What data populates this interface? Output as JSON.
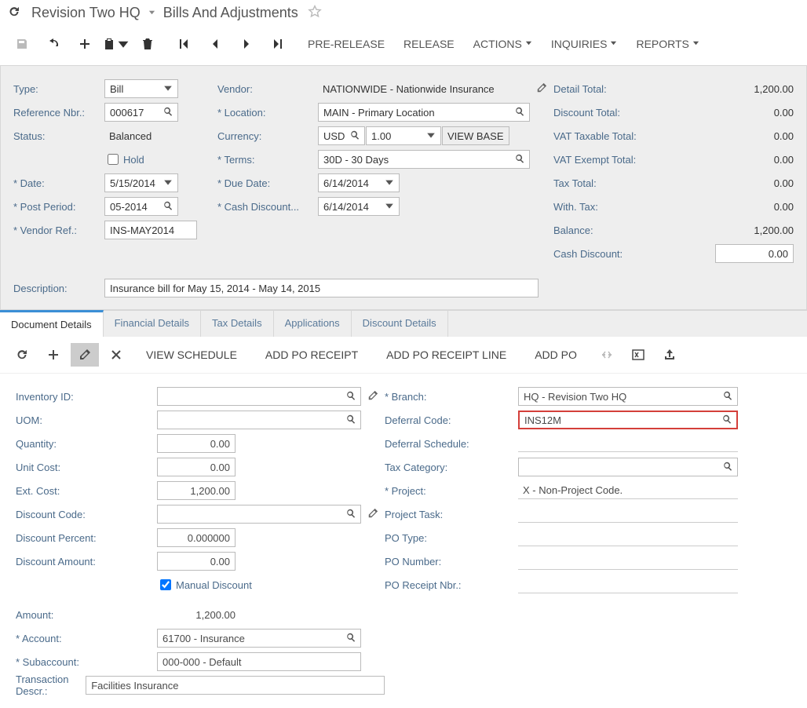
{
  "breadcrumb": {
    "company": "Revision Two HQ",
    "page": "Bills And Adjustments"
  },
  "toolbar": {
    "prerelease": "PRE-RELEASE",
    "release": "RELEASE",
    "actions": "ACTIONS",
    "inquiries": "INQUIRIES",
    "reports": "REPORTS"
  },
  "header": {
    "type_lbl": "Type:",
    "type": "Bill",
    "ref_lbl": "Reference Nbr.:",
    "ref": "000617",
    "status_lbl": "Status:",
    "status": "Balanced",
    "hold_lbl": "Hold",
    "date_lbl": "Date:",
    "date": "5/15/2014",
    "post_lbl": "Post Period:",
    "post": "05-2014",
    "vref_lbl": "Vendor Ref.:",
    "vref": "INS-MAY2014",
    "desc_lbl": "Description:",
    "desc": "Insurance bill for May 15, 2014 - May 14, 2015",
    "vendor_lbl": "Vendor:",
    "vendor": "NATIONWIDE - Nationwide Insurance",
    "location_lbl": "Location:",
    "location": "MAIN - Primary Location",
    "currency_lbl": "Currency:",
    "currency": "USD",
    "rate": "1.00",
    "viewbase": "VIEW BASE",
    "terms_lbl": "Terms:",
    "terms": "30D - 30 Days",
    "due_lbl": "Due Date:",
    "due": "6/14/2014",
    "cashdisc_lbl": "Cash Discount...",
    "cashdisc": "6/14/2014"
  },
  "totals": {
    "detail_lbl": "Detail Total:",
    "detail": "1,200.00",
    "discount_lbl": "Discount Total:",
    "discount": "0.00",
    "vattax_lbl": "VAT Taxable Total:",
    "vattax": "0.00",
    "vatex_lbl": "VAT Exempt Total:",
    "vatex": "0.00",
    "tax_lbl": "Tax Total:",
    "tax": "0.00",
    "with_lbl": "With. Tax:",
    "with": "0.00",
    "balance_lbl": "Balance:",
    "balance": "1,200.00",
    "cashdisc_lbl": "Cash Discount:",
    "cashdisc": "0.00"
  },
  "tabs": {
    "doc": "Document Details",
    "fin": "Financial Details",
    "tax": "Tax Details",
    "app": "Applications",
    "disc": "Discount Details"
  },
  "gridbar": {
    "viewsched": "VIEW SCHEDULE",
    "addpor": "ADD PO RECEIPT",
    "addporl": "ADD PO RECEIPT LINE",
    "addpo": "ADD PO"
  },
  "detail": {
    "inv_lbl": "Inventory ID:",
    "uom_lbl": "UOM:",
    "qty_lbl": "Quantity:",
    "qty": "0.00",
    "ucost_lbl": "Unit Cost:",
    "ucost": "0.00",
    "ecost_lbl": "Ext. Cost:",
    "ecost": "1,200.00",
    "dcode_lbl": "Discount Code:",
    "dpct_lbl": "Discount Percent:",
    "dpct": "0.000000",
    "damt_lbl": "Discount Amount:",
    "damt": "0.00",
    "mdisc_lbl": "Manual Discount",
    "amt_lbl": "Amount:",
    "amt": "1,200.00",
    "acct_lbl": "Account:",
    "acct": "61700 - Insurance",
    "sub_lbl": "Subaccount:",
    "sub": "000-000 - Default",
    "tdesc_lbl": "Transaction Descr.:",
    "tdesc": "Facilities Insurance",
    "branch_lbl": "Branch:",
    "branch": "HQ - Revision Two HQ",
    "defcode_lbl": "Deferral Code:",
    "defcode": "INS12M",
    "defsched_lbl": "Deferral Schedule:",
    "taxcat_lbl": "Tax Category:",
    "proj_lbl": "Project:",
    "proj": "X - Non-Project Code.",
    "ptask_lbl": "Project Task:",
    "potype_lbl": "PO Type:",
    "ponum_lbl": "PO Number:",
    "porcpt_lbl": "PO Receipt Nbr.:"
  }
}
